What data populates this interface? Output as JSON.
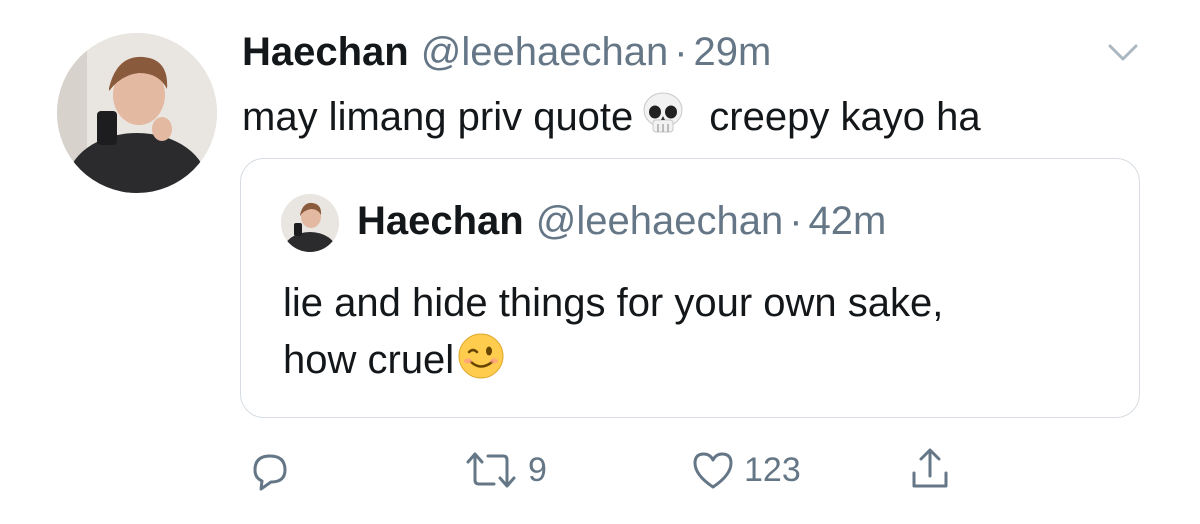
{
  "tweet": {
    "name": "Haechan",
    "handle": "@leehaechan",
    "dot": "·",
    "time": "29m",
    "text_before": "may limang priv quote",
    "text_after": "creepy kayo ha"
  },
  "quoted": {
    "name": "Haechan",
    "handle": "@leehaechan",
    "dot": "·",
    "time": "42m",
    "line1": "lie and hide things for your own sake,",
    "line2": "how cruel"
  },
  "actions": {
    "retweets": "9",
    "likes": "123"
  },
  "icons": {
    "more": "chevron-down-icon",
    "reply": "reply-icon",
    "retweet": "retweet-icon",
    "like": "heart-icon",
    "share": "share-icon",
    "emoji1": "skull-emoji",
    "emoji2": "winking-face-emoji"
  },
  "colors": {
    "text": "#14171a",
    "secondary": "#657786",
    "border": "#d7dde2"
  }
}
